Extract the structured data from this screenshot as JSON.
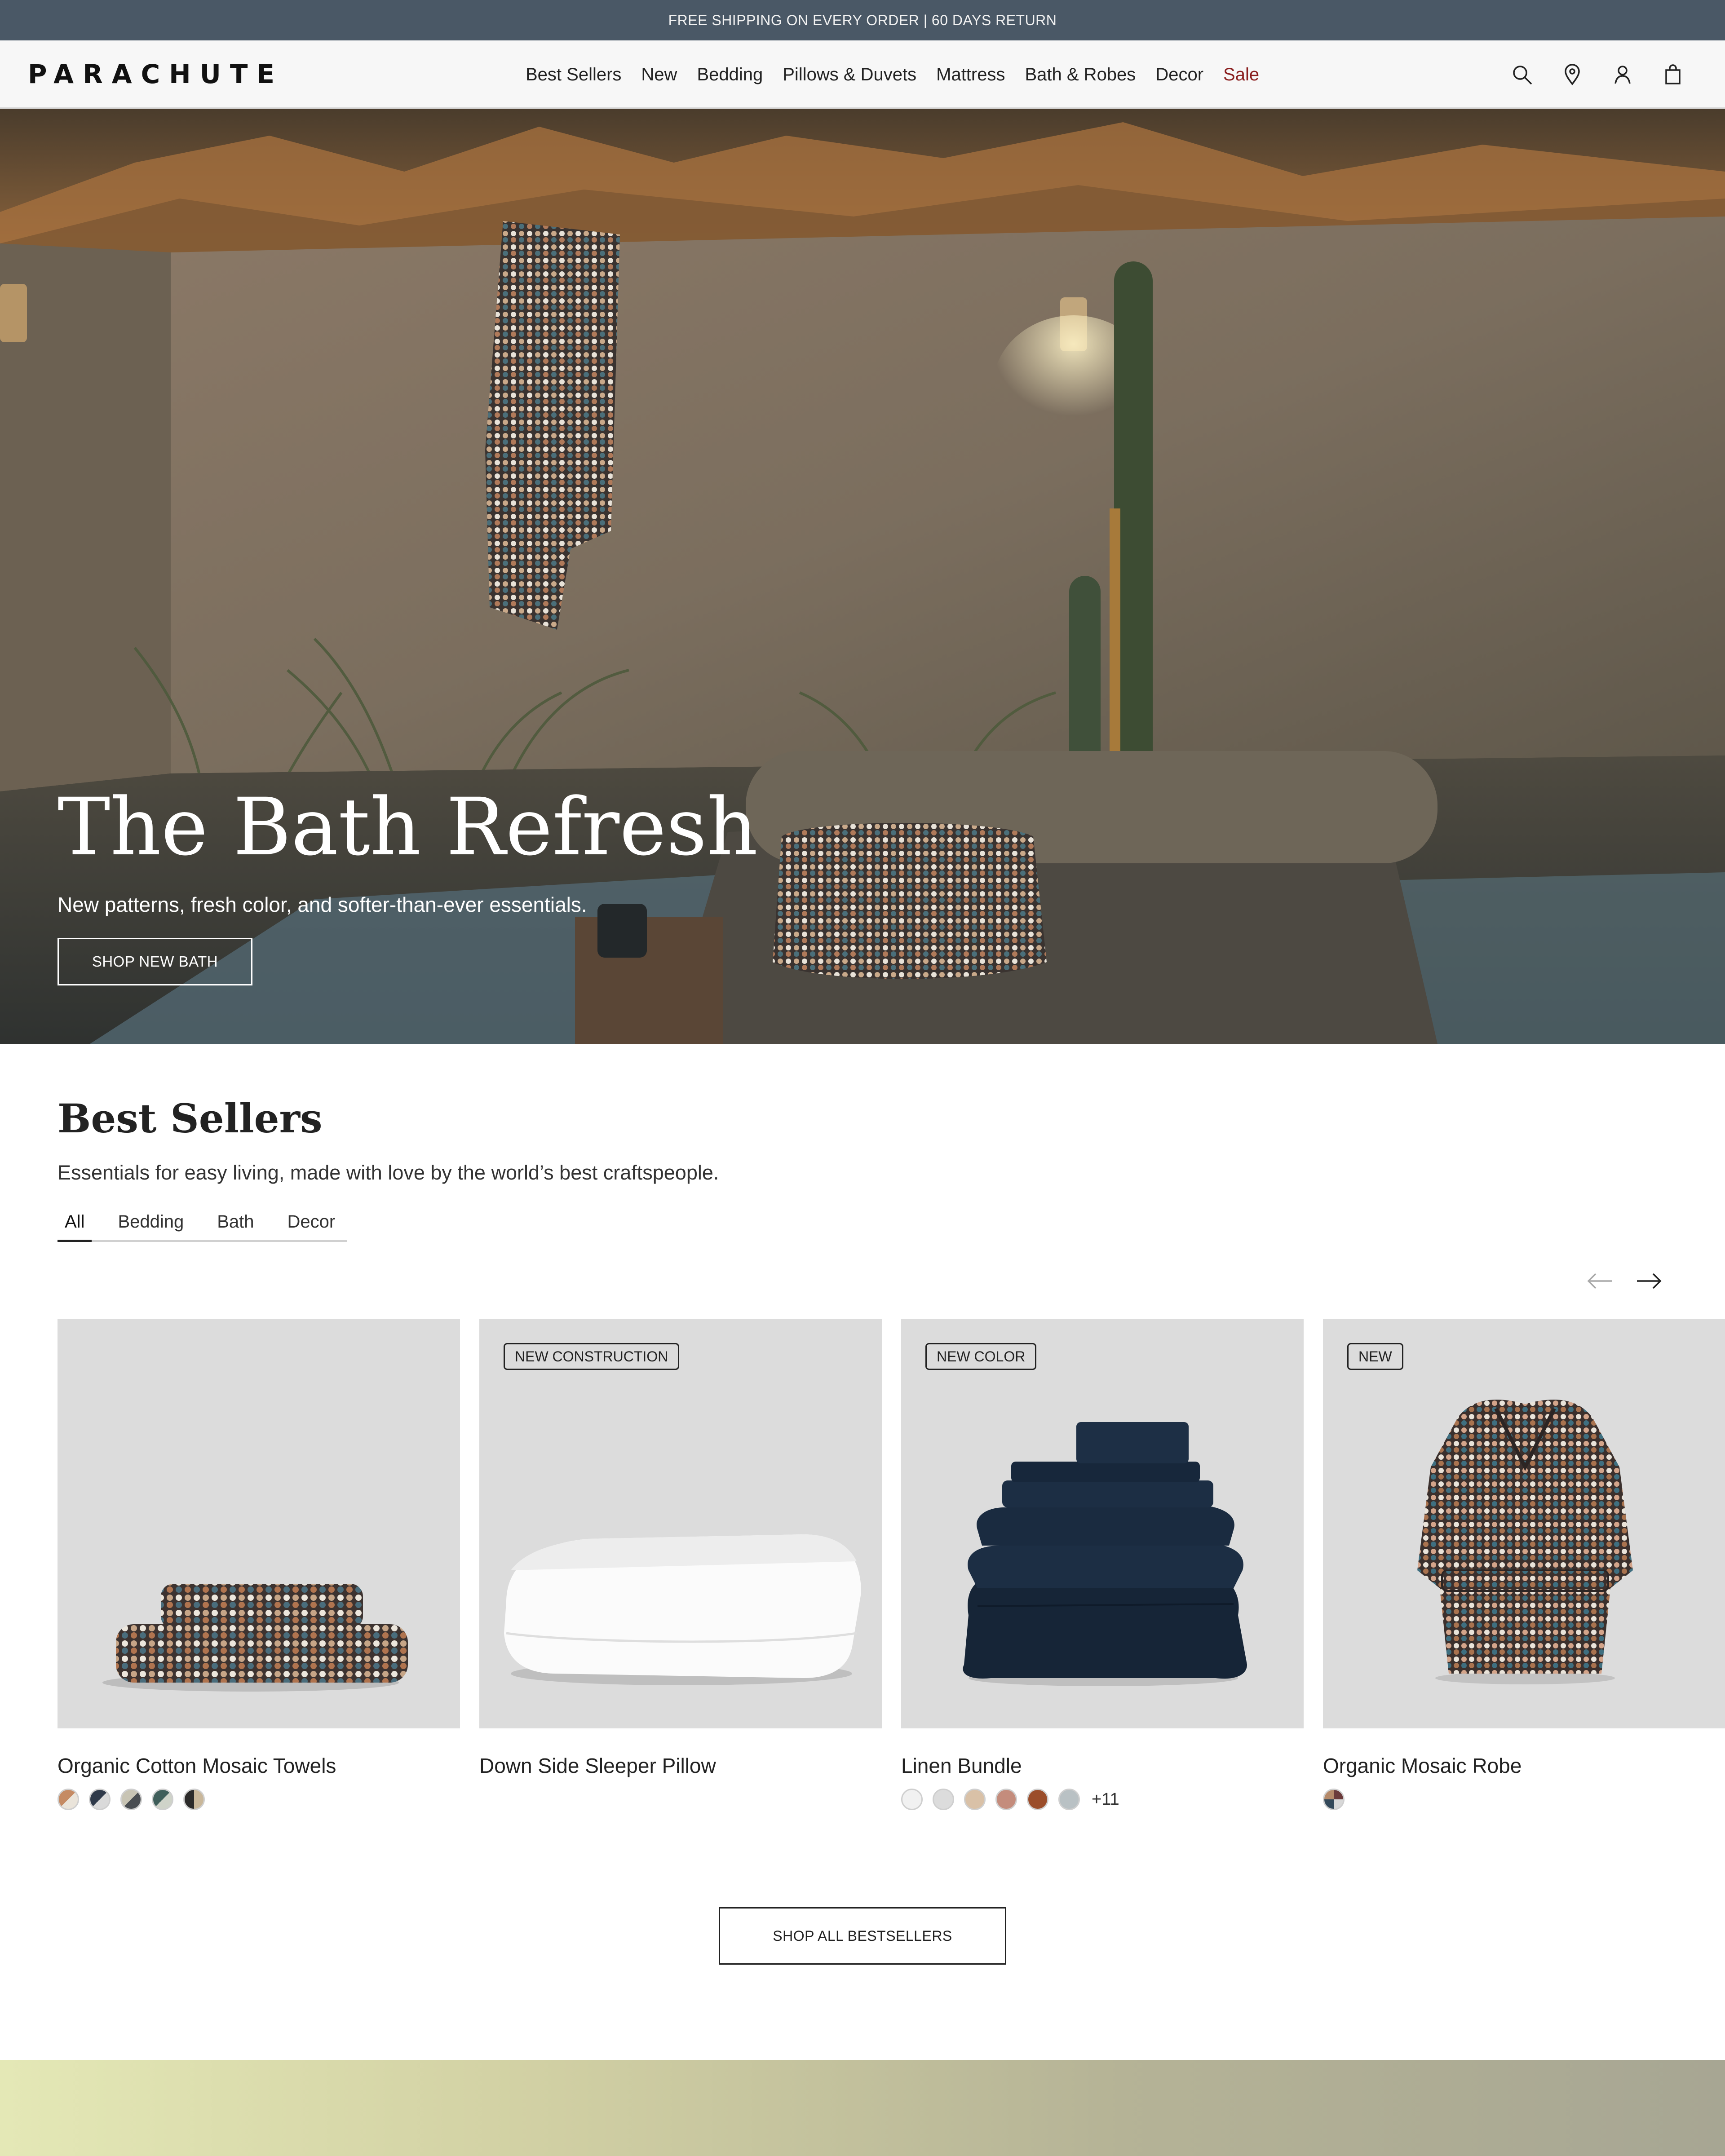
{
  "announcement": {
    "text": "FREE SHIPPING ON EVERY ORDER |  60 DAYS RETURN"
  },
  "header": {
    "logo": "PARACHUTE",
    "nav": [
      {
        "label": "Best Sellers"
      },
      {
        "label": "New"
      },
      {
        "label": "Bedding"
      },
      {
        "label": "Pillows & Duvets"
      },
      {
        "label": "Mattress"
      },
      {
        "label": "Bath & Robes"
      },
      {
        "label": "Decor"
      },
      {
        "label": "Sale"
      }
    ],
    "icons": [
      "search-icon",
      "location-pin-icon",
      "account-icon",
      "shopping-bag-icon"
    ],
    "sale_color": "#8a1e1e"
  },
  "hero": {
    "title": "The Bath Refresh",
    "subtitle": "New patterns, fresh color, and softer-than-ever essentials.",
    "cta": "SHOP NEW BATH"
  },
  "best_sellers": {
    "title": "Best Sellers",
    "subtitle": "Essentials for easy living, made with love by the world’s best craftspeople.",
    "tabs": [
      {
        "label": "All",
        "active": true
      },
      {
        "label": "Bedding",
        "active": false
      },
      {
        "label": "Bath",
        "active": false
      },
      {
        "label": "Decor",
        "active": false
      }
    ],
    "products": [
      {
        "name": "Organic Cotton Mosaic Towels",
        "badge": "",
        "swatches": [
          "#b87a5a",
          "#2f3a4a",
          "#c8c4b4",
          "#3f5e5a",
          "#c9b79a"
        ],
        "more": ""
      },
      {
        "name": "Down Side Sleeper Pillow",
        "badge": "NEW CONSTRUCTION",
        "swatches": [],
        "more": ""
      },
      {
        "name": "Linen Bundle",
        "badge": "NEW COLOR",
        "swatches": [
          "#f1f1f1",
          "#dcdcdc",
          "#d9c1a7",
          "#c48c7c",
          "#9b4d2a",
          "#b9c1c4"
        ],
        "more": "+11"
      },
      {
        "name": "Organic Mosaic Robe",
        "badge": "NEW",
        "swatches": [
          "#6b3b3b"
        ],
        "more": ""
      }
    ],
    "cta": "SHOP ALL BESTSELLERS"
  }
}
